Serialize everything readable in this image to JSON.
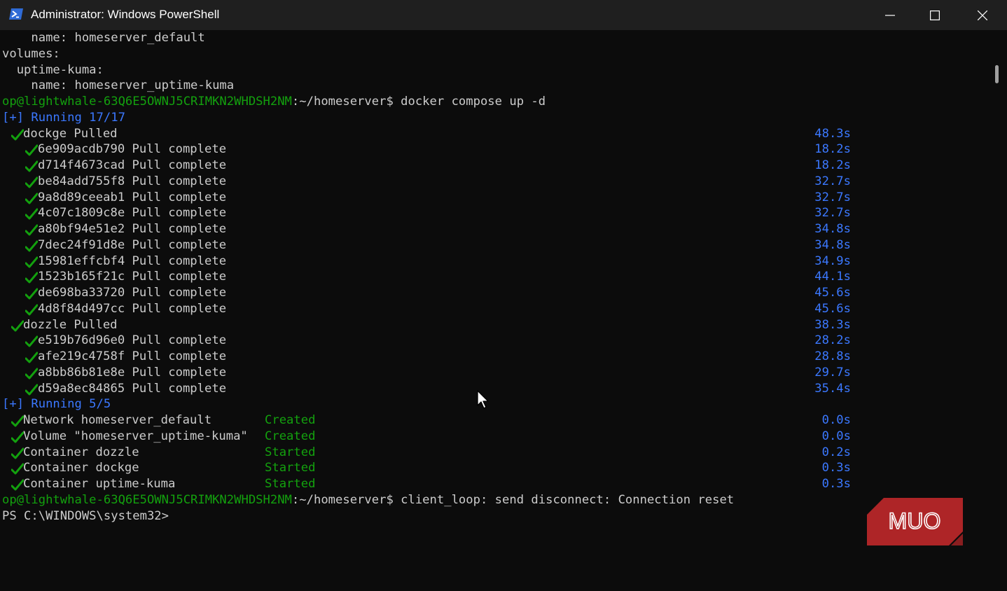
{
  "window": {
    "title": "Administrator: Windows PowerShell",
    "icon": "powershell-icon",
    "controls": [
      "minimize-icon",
      "maximize-icon",
      "close-icon"
    ]
  },
  "terminal": {
    "pre_lines": [
      "    name: homeserver_default",
      "volumes:",
      "  uptime-kuma:",
      "    name: homeserver_uptime-kuma"
    ],
    "prompt1": {
      "userhost": "op@lightwhale-63Q6E5OWNJ5CRIMKN2WHDSH2NM",
      "path_suffix": ":~/homeserver$ docker compose up -d"
    },
    "running1": "[+] Running 17/17",
    "images": [
      {
        "name": "dockge Pulled",
        "time": "48.3s",
        "layers": [
          {
            "text": "6e909acdb790 Pull complete",
            "time": "18.2s"
          },
          {
            "text": "d714f4673cad Pull complete",
            "time": "18.2s"
          },
          {
            "text": "be84add755f8 Pull complete",
            "time": "32.7s"
          },
          {
            "text": "9a8d89ceeab1 Pull complete",
            "time": "32.7s"
          },
          {
            "text": "4c07c1809c8e Pull complete",
            "time": "32.7s"
          },
          {
            "text": "a80bf94e51e2 Pull complete",
            "time": "34.8s"
          },
          {
            "text": "7dec24f91d8e Pull complete",
            "time": "34.8s"
          },
          {
            "text": "15981effcbf4 Pull complete",
            "time": "34.9s"
          },
          {
            "text": "1523b165f21c Pull complete",
            "time": "44.1s"
          },
          {
            "text": "de698ba33720 Pull complete",
            "time": "45.6s"
          },
          {
            "text": "4d8f84d497cc Pull complete",
            "time": "45.6s"
          }
        ]
      },
      {
        "name": "dozzle Pulled",
        "time": "38.3s",
        "layers": [
          {
            "text": "e519b76d96e0 Pull complete",
            "time": "28.2s"
          },
          {
            "text": "afe219c4758f Pull complete",
            "time": "28.8s"
          },
          {
            "text": "a8bb86b81e8e Pull complete",
            "time": "29.7s"
          },
          {
            "text": "d59a8ec84865 Pull complete",
            "time": "35.4s"
          }
        ]
      }
    ],
    "running2": "[+] Running 5/5",
    "resources": [
      {
        "text": "Network homeserver_default",
        "status": "Created",
        "time": "0.0s"
      },
      {
        "text": "Volume \"homeserver_uptime-kuma\"",
        "status": "Created",
        "time": "0.0s"
      },
      {
        "text": "Container dozzle",
        "status": "Started",
        "time": "0.2s"
      },
      {
        "text": "Container dockge",
        "status": "Started",
        "time": "0.3s"
      },
      {
        "text": "Container uptime-kuma",
        "status": "Started",
        "time": "0.3s"
      }
    ],
    "prompt2": {
      "userhost": "op@lightwhale-63Q6E5OWNJ5CRIMKN2WHDSH2NM",
      "path_suffix": ":~/homeserver$ client_loop: send disconnect: Connection reset"
    },
    "ps_prompt": "PS C:\\WINDOWS\\system32>"
  },
  "watermark": {
    "text": "MUO",
    "color": "#c0282a"
  },
  "colors": {
    "background": "#0c0c0c",
    "text": "#cccccc",
    "green": "#13a10e",
    "blue": "#3b78ff",
    "titlebar": "#1f1f1f"
  }
}
